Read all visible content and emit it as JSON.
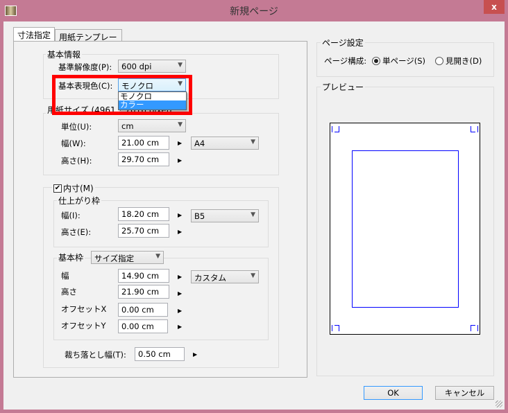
{
  "window": {
    "title": "新規ページ",
    "close": "x"
  },
  "tabs": [
    {
      "label": "寸法指定"
    },
    {
      "label": "用紙テンプレート"
    }
  ],
  "basic": {
    "group": "基本情報",
    "resolution_label": "基準解像度(P):",
    "resolution": "600 dpi",
    "color_label": "基本表現色(C):",
    "color": "モノクロ",
    "options": [
      "モノクロ",
      "カラー"
    ]
  },
  "paper": {
    "group": "用紙サイズ (4961 * 7016 pixel)",
    "unit_label": "単位(U):",
    "unit": "cm",
    "width_label": "幅(W):",
    "width": "21.00 cm",
    "height_label": "高さ(H):",
    "height": "29.70 cm",
    "preset": "A4"
  },
  "inner": {
    "checkbox": "内寸(M)",
    "checked": true,
    "finish": {
      "group": "仕上がり枠",
      "width_label": "幅(I):",
      "width": "18.20 cm",
      "height_label": "高さ(E):",
      "height": "25.70 cm",
      "preset": "B5"
    },
    "base": {
      "group": "基本枠",
      "mode": "サイズ指定",
      "width_label": "幅",
      "width": "14.90 cm",
      "height_label": "高さ",
      "height": "21.90 cm",
      "offx_label": "オフセットX",
      "offx": "0.00 cm",
      "offy_label": "オフセットY",
      "offy": "0.00 cm",
      "preset": "カスタム"
    },
    "bleed_label": "裁ち落とし幅(T):",
    "bleed": "0.50 cm"
  },
  "page_settings": {
    "group": "ページ設定",
    "layout_label": "ページ構成:",
    "single": "単ページ(S)",
    "spread": "見開き(D)",
    "selected": "single"
  },
  "preview": {
    "group": "プレビュー"
  },
  "buttons": {
    "ok": "OK",
    "cancel": "キャンセル"
  },
  "colors": {
    "titlebar": "#c47a94",
    "highlight": "#ff0000",
    "selection": "#3399ff"
  }
}
